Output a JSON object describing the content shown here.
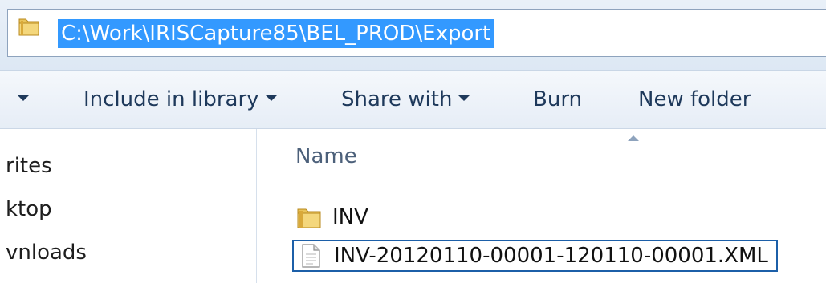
{
  "address_bar": {
    "path": "C:\\Work\\IRISCapture85\\BEL_PROD\\Export",
    "icon": "folder-icon"
  },
  "toolbar": {
    "items": [
      {
        "label": "",
        "has_dropdown": true
      },
      {
        "label": "Include in library",
        "has_dropdown": true
      },
      {
        "label": "Share with",
        "has_dropdown": true
      },
      {
        "label": "Burn",
        "has_dropdown": false
      },
      {
        "label": "New folder",
        "has_dropdown": false
      }
    ]
  },
  "nav_pane": {
    "items": [
      {
        "label": "rites"
      },
      {
        "label": "ktop"
      },
      {
        "label": "vnloads"
      }
    ]
  },
  "file_list": {
    "column_header": "Name",
    "sort_direction": "ascending",
    "files": [
      {
        "name": "INV",
        "type": "folder",
        "icon": "folder-icon",
        "selected": false
      },
      {
        "name": "INV-20120110-00001-120110-00001.XML",
        "type": "file",
        "icon": "document-icon",
        "selected": true
      }
    ]
  },
  "colors": {
    "selection_highlight": "#3399ff",
    "toolbar_text": "#1e395b",
    "selected_border": "#1c5fa8"
  }
}
